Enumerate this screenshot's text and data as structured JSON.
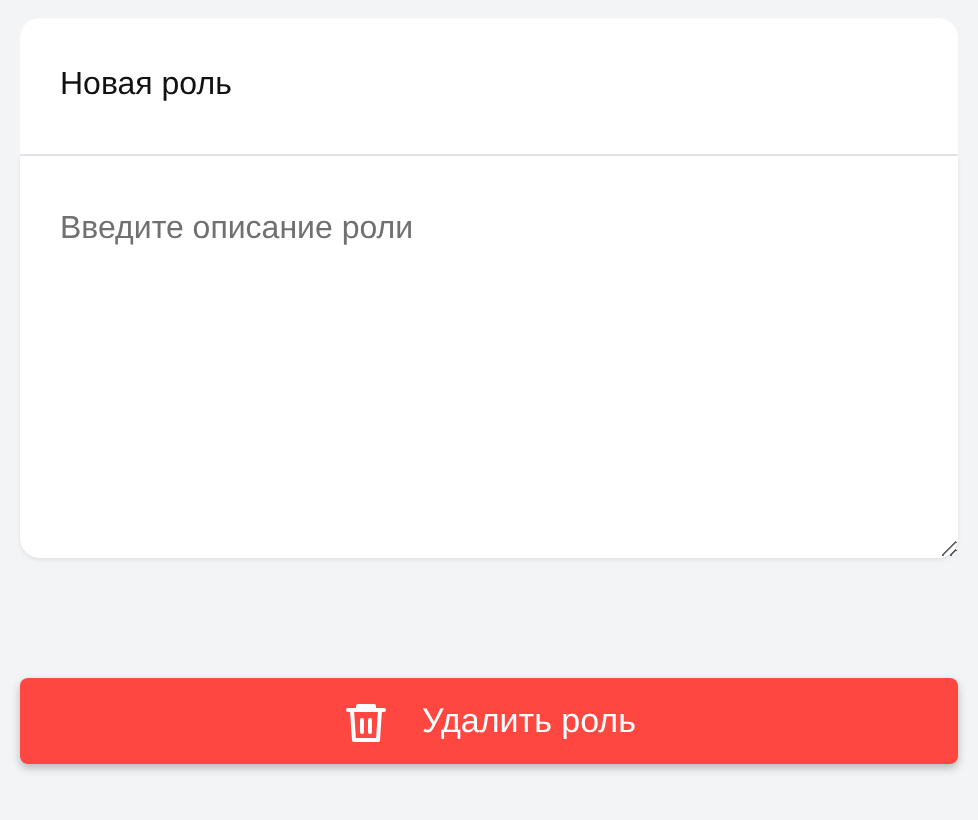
{
  "name_field": {
    "value": "Новая роль"
  },
  "description_field": {
    "placeholder": "Введите описание роли"
  },
  "delete_button": {
    "label": "Удалить роль"
  }
}
